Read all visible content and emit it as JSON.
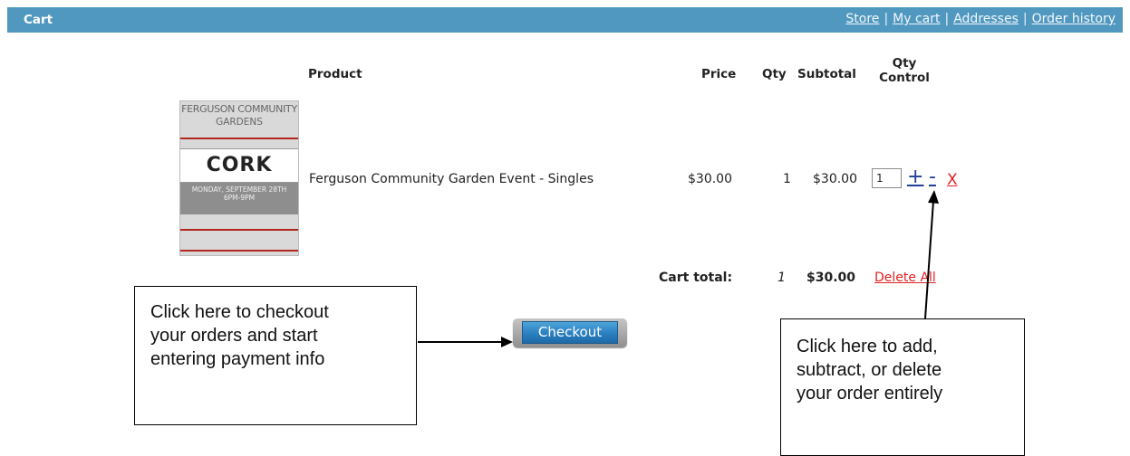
{
  "header": {
    "title": "Cart",
    "nav": [
      "Store",
      "My cart",
      "Addresses",
      "Order history"
    ],
    "separator": "|",
    "colors": {
      "bar": "#5198c0",
      "text": "#ffffff"
    }
  },
  "table": {
    "columns": {
      "product": "Product",
      "price": "Price",
      "qty": "Qty",
      "subtotal": "Subtotal",
      "qty_control_line1": "Qty",
      "qty_control_line2": "Control"
    },
    "rows": [
      {
        "name": "Ferguson Community Garden Event - Singles",
        "price": "$30.00",
        "qty": "1",
        "subtotal": "$30.00",
        "qty_input_value": "1",
        "controls": {
          "add": "+",
          "subtract": "-",
          "delete": "X"
        },
        "thumbnail": {
          "title_line1": "FERGUSON COMMUNITY",
          "title_line2": "GARDENS",
          "logo": "CORK",
          "date_line1": "MONDAY, SEPTEMBER 28TH",
          "date_line2": "6PM-9PM"
        }
      }
    ]
  },
  "totals": {
    "label": "Cart total:",
    "qty": "1",
    "amount": "$30.00",
    "delete_all": "Delete All"
  },
  "checkout": {
    "label": "Checkout"
  },
  "callouts": {
    "checkout": "Click here to checkout\nyour orders and start\nentering payment info",
    "controls": "Click here to add,\nsubtract, or delete\nyour order entirely"
  },
  "colors": {
    "link_blue": "#1f3f98",
    "delete_red": "#e02020",
    "button_blue": "#2a7fc0"
  }
}
